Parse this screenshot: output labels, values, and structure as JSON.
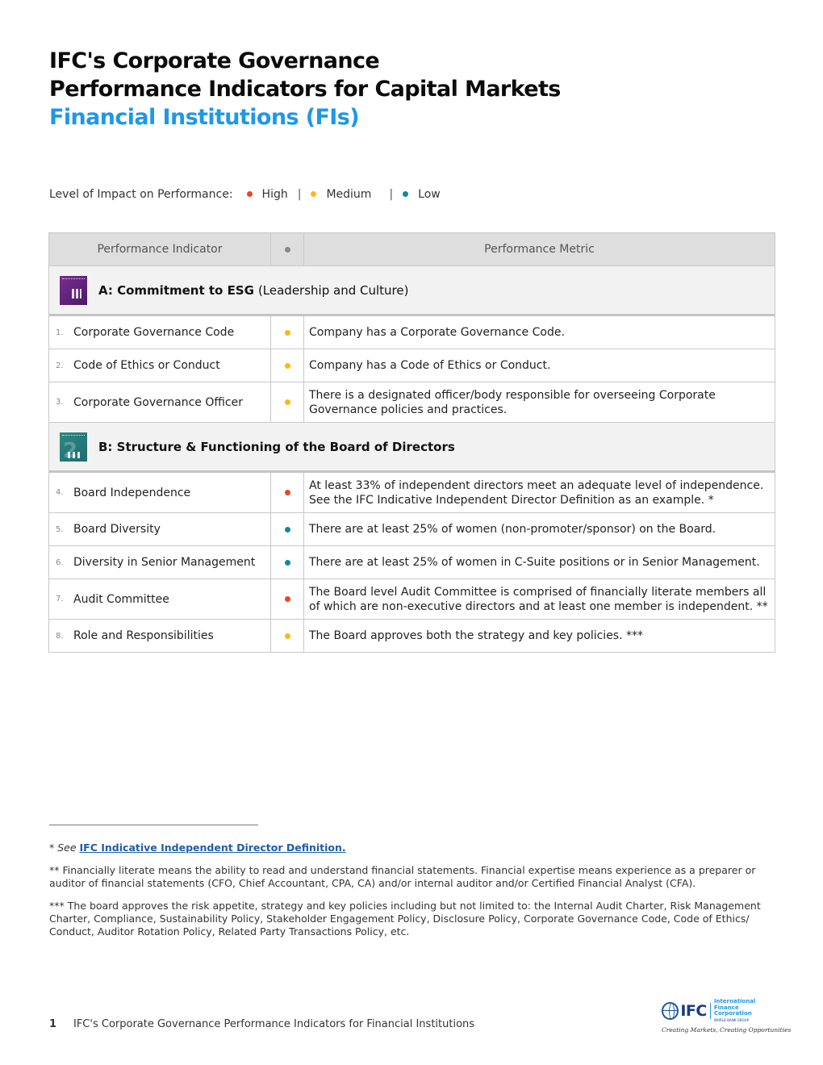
{
  "title": {
    "line1": "IFC's Corporate Governance",
    "line2": "Performance Indicators for Capital Markets",
    "line3": "Financial Institutions (FIs)"
  },
  "legend": {
    "label": "Level of Impact on Performance:",
    "separator": "|",
    "levels": [
      {
        "name": "High",
        "color": "#e8461e"
      },
      {
        "name": "Medium",
        "color": "#fdb813"
      },
      {
        "name": "Low",
        "color": "#0e8a9c"
      }
    ]
  },
  "table": {
    "headers": {
      "indicator": "Performance Indicator",
      "impact_icon": "dot-icon",
      "metric": "Performance Metric"
    },
    "sections": [
      {
        "icon": "leadership-culture-icon",
        "title_bold": "A: Commitment to ESG",
        "title_rest": "(Leadership and Culture)",
        "rows": [
          {
            "num": "1.",
            "indicator": "Corporate Governance Code",
            "impact": "Medium",
            "color": "#fdb813",
            "metric": "Company has a Corporate Governance Code."
          },
          {
            "num": "2.",
            "indicator": "Code of Ethics or Conduct",
            "impact": "Medium",
            "color": "#fdb813",
            "metric": "Company has a Code of Ethics or Conduct."
          },
          {
            "num": "3.",
            "indicator": "Corporate Governance Officer",
            "impact": "Medium",
            "color": "#fdb813",
            "metric": "There is a designated officer/body responsible for overseeing Corporate Governance policies and practices."
          }
        ]
      },
      {
        "icon": "board-of-directors-icon",
        "title_bold": "B: Structure & Functioning of the Board of Directors",
        "title_rest": "",
        "rows": [
          {
            "num": "4.",
            "indicator": "Board Independence",
            "impact": "High",
            "color": "#e8461e",
            "metric": "At least 33% of independent directors meet an adequate level of independence. See the IFC Indicative Independent Director Definition as an example. *"
          },
          {
            "num": "5.",
            "indicator": "Board Diversity",
            "impact": "Low",
            "color": "#0e8a9c",
            "metric": "There are at least 25% of women (non-promoter/sponsor) on the Board."
          },
          {
            "num": "6.",
            "indicator": "Diversity in Senior Management",
            "impact": "Low",
            "color": "#0e8a9c",
            "metric": "There are at least 25% of women in C-Suite positions or in Senior Management."
          },
          {
            "num": "7.",
            "indicator": "Audit Committee",
            "impact": "High",
            "color": "#e8461e",
            "metric": "The Board level Audit Committee is comprised of financially literate members all of which are non-executive directors and at least one member is independent. **"
          },
          {
            "num": "8.",
            "indicator": "Role and Responsibilities",
            "impact": "Medium",
            "color": "#fdb813",
            "metric": "The Board approves both the strategy and key policies. ***"
          }
        ]
      }
    ]
  },
  "footnotes": {
    "fn1_prefix": "* See",
    "fn1_link": "IFC Indicative Independent Director Definition.",
    "fn2": "** Financially literate means the ability to read and understand financial statements. Financial expertise means experience as a preparer or auditor of financial statements (CFO, Chief Accountant, CPA, CA) and/or internal auditor and/or Certified Financial Analyst (CFA).",
    "fn3": "*** The board approves the risk appetite, strategy and key policies including but not limited to: the Internal Audit Charter, Risk Management Charter, Compliance, Sustainability Policy, Stakeholder Engagement Policy, Disclosure Policy, Corporate Governance Code, Code of Ethics/ Conduct, Auditor Rotation Policy, Related Party Transactions Policy, etc."
  },
  "footer": {
    "page_number": "1",
    "text": "IFC's Corporate Governance Performance Indicators for Financial Institutions"
  },
  "logo": {
    "acronym": "IFC",
    "name_line1": "International",
    "name_line2": "Finance Corporation",
    "group": "WORLD BANK GROUP",
    "tagline": "Creating Markets, Creating Opportunities"
  }
}
